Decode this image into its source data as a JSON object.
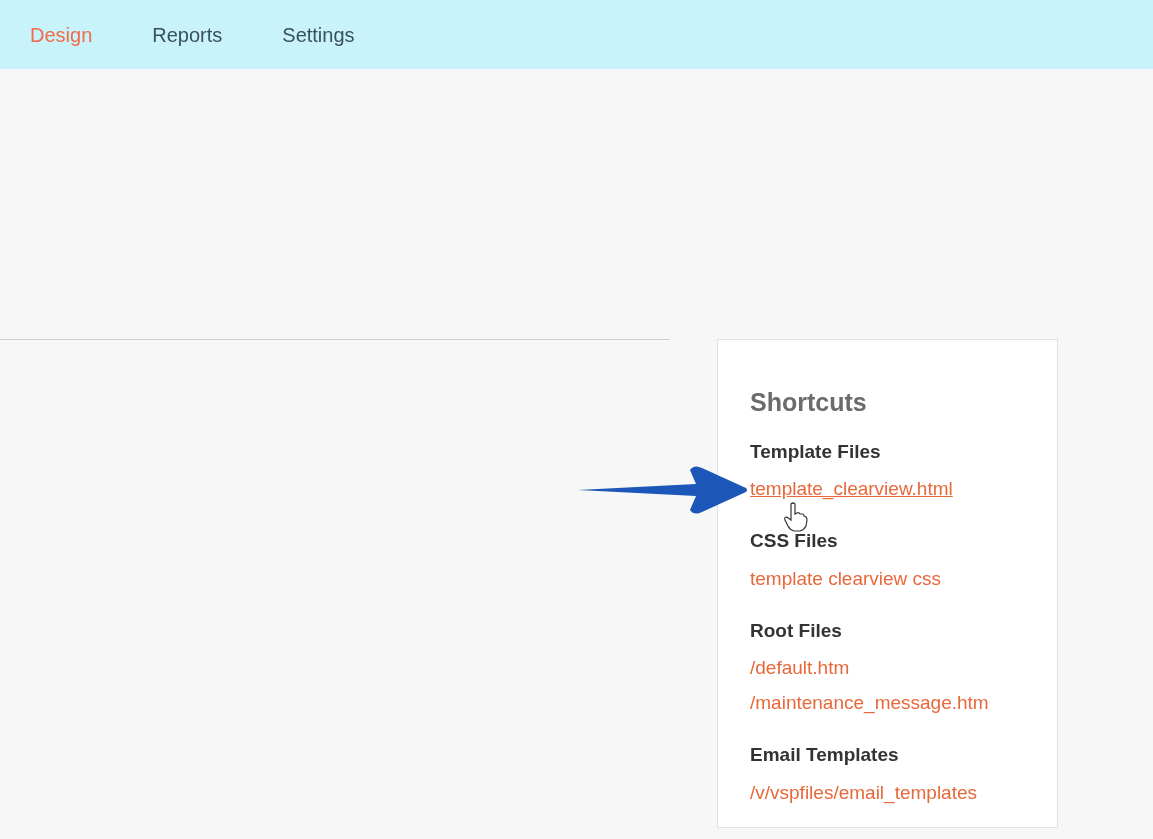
{
  "nav": {
    "tabs": [
      {
        "label": "Design",
        "selected": true
      },
      {
        "label": "Reports",
        "selected": false
      },
      {
        "label": "Settings",
        "selected": false
      }
    ]
  },
  "shortcuts": {
    "title": "Shortcuts",
    "groups": [
      {
        "heading": "Template Files",
        "links": [
          {
            "label": "template_clearview.html",
            "hovered": true
          }
        ]
      },
      {
        "heading": "CSS Files",
        "links": [
          {
            "label": "template clearview css",
            "hovered": false
          }
        ]
      },
      {
        "heading": "Root Files",
        "links": [
          {
            "label": "/default.htm",
            "hovered": false
          },
          {
            "label": "/maintenance_message.htm",
            "hovered": false
          }
        ]
      },
      {
        "heading": "Email Templates",
        "links": [
          {
            "label": "/v/vspfiles/email_templates",
            "hovered": false
          }
        ]
      }
    ]
  }
}
